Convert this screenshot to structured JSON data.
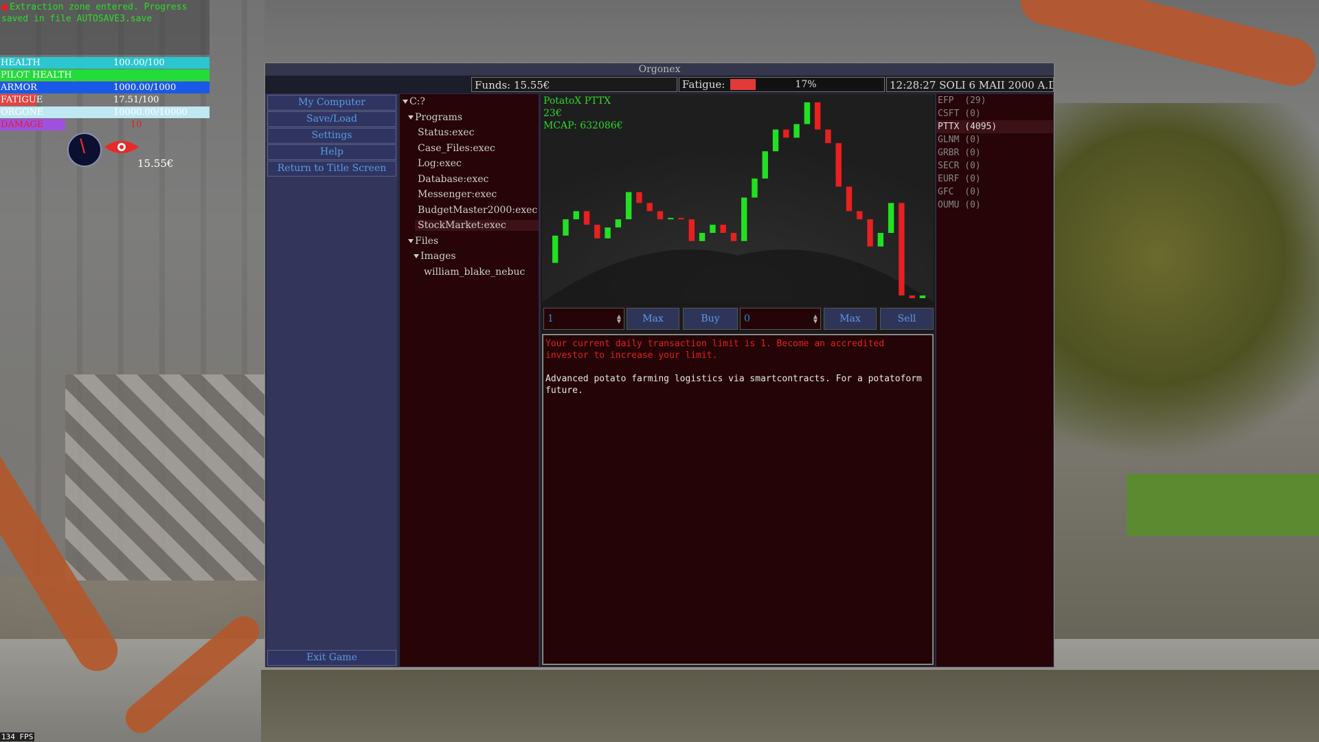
{
  "hud": {
    "message": "Extraction zone entered. Progress saved in file AUTOSAVE3.save",
    "bars": [
      {
        "label": "HEALTH",
        "value": "100.00/100",
        "fraction": 1.0,
        "color": "#2bc6cf"
      },
      {
        "label": "PILOT HEALTH",
        "value": "",
        "fraction": 1.0,
        "color": "#22dc3a"
      },
      {
        "label": "ARMOR",
        "value": "1000.00/1000",
        "fraction": 1.0,
        "color": "#1a58e8"
      },
      {
        "label": "FATIGUE",
        "value": "17.51/100",
        "fraction": 0.175,
        "color": "#e04545"
      },
      {
        "label": "ORGONE",
        "value": "10000.00/10000",
        "fraction": 1.0,
        "color": "#bfe8f2"
      },
      {
        "label": "DAMAGE",
        "value": "10",
        "fraction": 0.31,
        "color": "#a050e0"
      }
    ],
    "funds": "15.55€",
    "fps": "134 FPS"
  },
  "window": {
    "title": "Orgonex",
    "funds": "Funds: 15.55€",
    "fatigue_label": "Fatigue:",
    "fatigue_percent": "17%",
    "fatigue_fraction": 0.17,
    "clock": "12:28:27 SOLI 6 MAII 2000 A.D"
  },
  "nav": {
    "items": [
      "My Computer",
      "Save/Load",
      "Settings",
      "Help",
      "Return to Title Screen"
    ],
    "exit": "Exit Game"
  },
  "tree": {
    "root": "C:?",
    "programs": "Programs",
    "program_items": [
      "Status:exec",
      "Case_Files:exec",
      "Log:exec",
      "Database:exec",
      "Messenger:exec",
      "BudgetMaster2000:exec",
      "StockMarket:exec"
    ],
    "files": "Files",
    "images": "Images",
    "image_item": "william_blake_nebuc"
  },
  "stock": {
    "name": "PotatoX PTTX",
    "price": "23€",
    "mcap": "MCAP: 632086€",
    "buy_qty": "1",
    "sell_qty": "0",
    "max_label": "Max",
    "buy_label": "Buy",
    "sell_label": "Sell",
    "limit_msg": "Your current daily transaction limit is 1. Become an accredited investor to increase your limit.",
    "description": "Advanced potato farming logistics via smartcontracts. For a potatoform future."
  },
  "tickers": [
    {
      "label": "EFP  (29)",
      "active": false
    },
    {
      "label": "CSFT (0)",
      "active": false
    },
    {
      "label": "PTTX (4095)",
      "active": true
    },
    {
      "label": "GLNM (0)",
      "active": false
    },
    {
      "label": "GRBR (0)",
      "active": false
    },
    {
      "label": "SECR (0)",
      "active": false
    },
    {
      "label": "EURF (0)",
      "active": false
    },
    {
      "label": "GFC  (0)",
      "active": false
    },
    {
      "label": "OUMU (0)",
      "active": false
    }
  ],
  "chart_data": {
    "type": "bar",
    "colors": {
      "up": "#22e022",
      "down": "#e82020"
    },
    "candles": [
      {
        "o": 14,
        "c": 24
      },
      {
        "o": 24,
        "c": 30
      },
      {
        "o": 30,
        "c": 33
      },
      {
        "o": 33,
        "c": 28
      },
      {
        "o": 28,
        "c": 23
      },
      {
        "o": 23,
        "c": 27
      },
      {
        "o": 27,
        "c": 30
      },
      {
        "o": 30,
        "c": 40
      },
      {
        "o": 40,
        "c": 36
      },
      {
        "o": 36,
        "c": 33
      },
      {
        "o": 33,
        "c": 30
      },
      {
        "o": 30,
        "c": 30.5
      },
      {
        "o": 30.5,
        "c": 30
      },
      {
        "o": 30,
        "c": 22
      },
      {
        "o": 22,
        "c": 25
      },
      {
        "o": 25,
        "c": 28
      },
      {
        "o": 28,
        "c": 25
      },
      {
        "o": 25,
        "c": 22
      },
      {
        "o": 22,
        "c": 38
      },
      {
        "o": 38,
        "c": 45
      },
      {
        "o": 45,
        "c": 55
      },
      {
        "o": 55,
        "c": 63
      },
      {
        "o": 63,
        "c": 60
      },
      {
        "o": 60,
        "c": 65
      },
      {
        "o": 65,
        "c": 73
      },
      {
        "o": 73,
        "c": 63
      },
      {
        "o": 63,
        "c": 58
      },
      {
        "o": 58,
        "c": 42
      },
      {
        "o": 42,
        "c": 33
      },
      {
        "o": 33,
        "c": 30
      },
      {
        "o": 30,
        "c": 20
      },
      {
        "o": 20,
        "c": 25
      },
      {
        "o": 25,
        "c": 36
      },
      {
        "o": 36,
        "c": 2
      },
      {
        "o": 2,
        "c": 1
      },
      {
        "o": 1,
        "c": 2
      }
    ],
    "ylim": [
      0,
      75
    ]
  }
}
